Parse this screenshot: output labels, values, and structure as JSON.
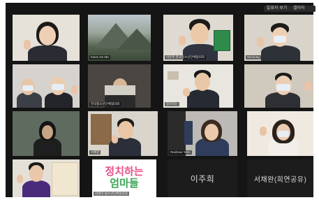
{
  "topbar": {
    "control_a": "발표자 보기",
    "control_b": "갤러리"
  },
  "participants": [
    {
      "name": ""
    },
    {
      "name": "Kwon Do Ma"
    },
    {
      "name": "이은주 한국청소년단체협의회"
    },
    {
      "name": "SeoJung"
    },
    {
      "name": ""
    },
    {
      "name": "한국청소년단체협의회"
    },
    {
      "name": "정치하는"
    },
    {
      "name": ""
    },
    {
      "name": ""
    },
    {
      "name": "서채원"
    },
    {
      "name": "Rainbow Yerin"
    },
    {
      "name": ""
    },
    {
      "name": ""
    },
    {
      "name": "김영미 청소년단체협의회"
    },
    {
      "name": "이주희"
    },
    {
      "name": "서채완(희연공유)"
    }
  ],
  "logo_tile": {
    "line1": "정치하는",
    "line2": "엄마들"
  },
  "colors": {
    "background": "#151515",
    "tile": "#262626",
    "accent_pink": "#e8508c",
    "accent_green": "#3aa657",
    "accent_orange": "#f39a2e",
    "accent_blue": "#3c7bd6"
  }
}
